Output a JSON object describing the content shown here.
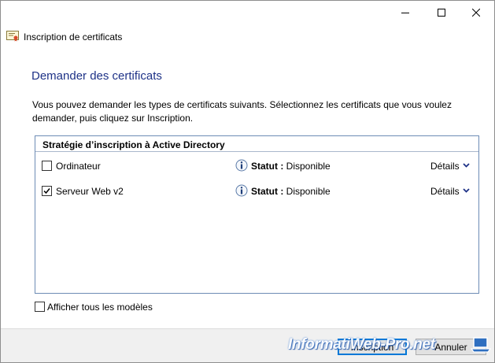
{
  "window": {
    "title": "Inscription de certificats"
  },
  "heading": "Demander des certificats",
  "description": "Vous pouvez demander les types de certificats suivants. Sélectionnez les certificats que vous voulez demander, puis cliquez sur Inscription.",
  "policy": {
    "title": "Stratégie d’inscription à Active Directory",
    "items": [
      {
        "name": "Ordinateur",
        "checked": false,
        "status_label": "Statut :",
        "status_value": "Disponible",
        "details_label": "Détails"
      },
      {
        "name": "Serveur Web v2",
        "checked": true,
        "status_label": "Statut :",
        "status_value": "Disponible",
        "details_label": "Détails"
      }
    ]
  },
  "show_all": {
    "label": "Afficher tous les modèles",
    "checked": false
  },
  "buttons": {
    "enroll": "Inscription",
    "cancel": "Annuler"
  },
  "watermark": "InformatiWeb-Pro.net",
  "colors": {
    "heading": "#1e3287",
    "panel_border": "#6d8cb5",
    "primary_border": "#0078d7",
    "footer_bg": "#f0f0f0"
  }
}
